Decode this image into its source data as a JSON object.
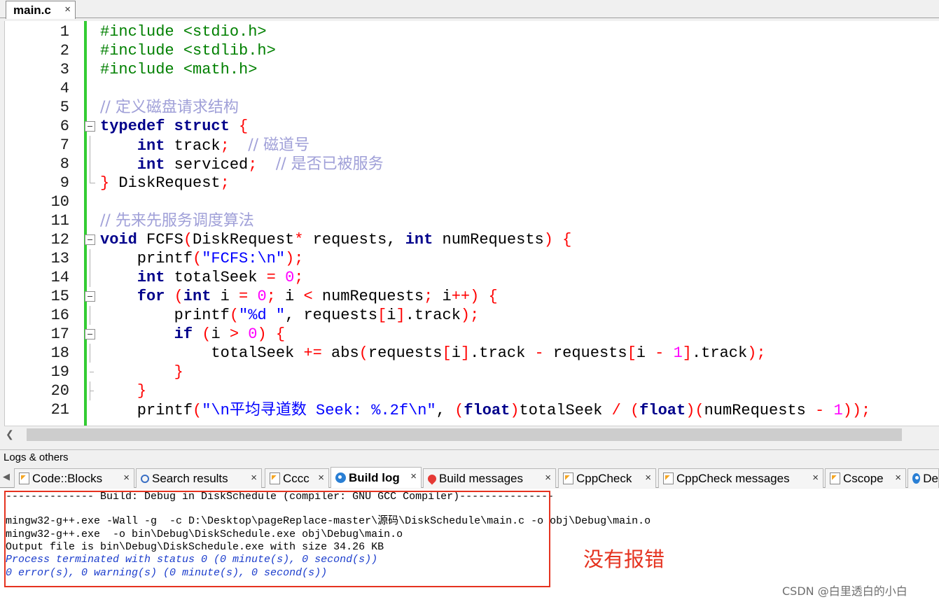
{
  "editor_tab": {
    "label": "main.c",
    "close": "×"
  },
  "code_lines": [
    {
      "n": "1",
      "text": "#include <stdio.h>"
    },
    {
      "n": "2",
      "text": "#include <stdlib.h>"
    },
    {
      "n": "3",
      "text": "#include <math.h>"
    },
    {
      "n": "4",
      "text": ""
    },
    {
      "n": "5",
      "text": "// 定义磁盘请求结构"
    },
    {
      "n": "6",
      "text": "typedef struct {"
    },
    {
      "n": "7",
      "text": "    int track;  // 磁道号"
    },
    {
      "n": "8",
      "text": "    int serviced;  // 是否已被服务"
    },
    {
      "n": "9",
      "text": "} DiskRequest;"
    },
    {
      "n": "10",
      "text": ""
    },
    {
      "n": "11",
      "text": "// 先来先服务调度算法"
    },
    {
      "n": "12",
      "text": "void FCFS(DiskRequest* requests, int numRequests) {"
    },
    {
      "n": "13",
      "text": "    printf(\"FCFS:\\n\");"
    },
    {
      "n": "14",
      "text": "    int totalSeek = 0;"
    },
    {
      "n": "15",
      "text": "    for (int i = 0; i < numRequests; i++) {"
    },
    {
      "n": "16",
      "text": "        printf(\"%d \", requests[i].track);"
    },
    {
      "n": "17",
      "text": "        if (i > 0) {"
    },
    {
      "n": "18",
      "text": "            totalSeek += abs(requests[i].track - requests[i - 1].track);"
    },
    {
      "n": "19",
      "text": "        }"
    },
    {
      "n": "20",
      "text": "    }"
    },
    {
      "n": "21",
      "text": "    printf(\"\\n平均寻道数 Seek: %.2f\\n\", (float)totalSeek / (float)(numRequests - 1));"
    }
  ],
  "logs_panel": {
    "title": "Logs & others",
    "tabs": [
      {
        "label": "Code::Blocks",
        "icon": "document-icon"
      },
      {
        "label": "Search results",
        "icon": "search-icon"
      },
      {
        "label": "Cccc",
        "icon": "document-icon"
      },
      {
        "label": "Build log",
        "icon": "gear-icon",
        "active": true
      },
      {
        "label": "Build messages",
        "icon": "pin-icon"
      },
      {
        "label": "CppCheck",
        "icon": "document-icon"
      },
      {
        "label": "CppCheck messages",
        "icon": "document-icon"
      },
      {
        "label": "Cscope",
        "icon": "document-icon"
      },
      {
        "label": "De",
        "icon": "gear-icon"
      }
    ],
    "close": "×"
  },
  "build_log": [
    "-------------- Build: Debug in DiskSchedule (compiler: GNU GCC Compiler)---------------",
    "",
    "mingw32-g++.exe -Wall -g  -c D:\\Desktop\\pageReplace-master\\源码\\DiskSchedule\\main.c -o obj\\Debug\\main.o",
    "mingw32-g++.exe  -o bin\\Debug\\DiskSchedule.exe obj\\Debug\\main.o",
    "Output file is bin\\Debug\\DiskSchedule.exe with size 34.26 KB",
    "Process terminated with status 0 (0 minute(s), 0 second(s))",
    "0 error(s), 0 warning(s) (0 minute(s), 0 second(s))"
  ],
  "annotation": "没有报错",
  "watermark": "CSDN @白里透白的小白",
  "colors": {
    "annotation": "#e53320",
    "gutter_marker": "#33cc33",
    "log_status": "#1a3ccc"
  }
}
